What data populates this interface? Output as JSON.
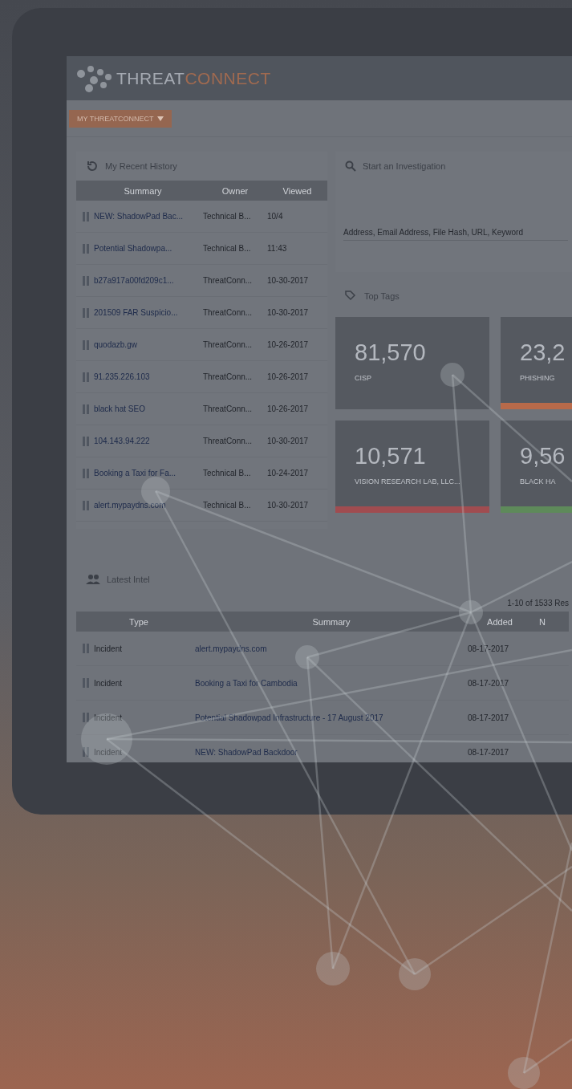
{
  "header": {
    "logo_primary": "THREAT",
    "logo_accent": "CONNECT"
  },
  "menu_button": "MY THREATCONNECT",
  "recent_history": {
    "title": "My Recent History",
    "columns": [
      "Summary",
      "Owner",
      "Viewed"
    ],
    "rows": [
      {
        "summary": "NEW: ShadowPad Bac...",
        "owner": "Technical B...",
        "viewed": "10/4"
      },
      {
        "summary": "Potential Shadowpa...",
        "owner": "Technical B...",
        "viewed": "11:43"
      },
      {
        "summary": "b27a917a00fd209c1...",
        "owner": "ThreatConn...",
        "viewed": "10-30-2017"
      },
      {
        "summary": "201509 FAR Suspicio...",
        "owner": "ThreatConn...",
        "viewed": "10-30-2017"
      },
      {
        "summary": "quodazb.gw",
        "owner": "ThreatConn...",
        "viewed": "10-26-2017"
      },
      {
        "summary": "91.235.226.103",
        "owner": "ThreatConn...",
        "viewed": "10-26-2017"
      },
      {
        "summary": "black hat SEO",
        "owner": "ThreatConn...",
        "viewed": "10-26-2017"
      },
      {
        "summary": "104.143.94.222",
        "owner": "ThreatConn...",
        "viewed": "10-30-2017"
      },
      {
        "summary": "Booking a Taxi for Fa...",
        "owner": "Technical B...",
        "viewed": "10-24-2017"
      },
      {
        "summary": "alert.mypaydns.com",
        "owner": "Technical B...",
        "viewed": "10-30-2017"
      }
    ]
  },
  "investigation": {
    "title": "Start an Investigation",
    "placeholder": "Address, Email Address, File Hash, URL, Keyword"
  },
  "top_tags": {
    "title": "Top Tags",
    "cards": [
      {
        "count": "81,570",
        "name": "CISP"
      },
      {
        "count": "23,2",
        "name": "PHISHING",
        "color": "#b86a4a"
      },
      {
        "count": "10,571",
        "name": "VISION RESEARCH LAB, LLC...",
        "color": "#a04c50"
      },
      {
        "count": "9,56",
        "name": "BLACK HA",
        "color": "#5e8a5a"
      }
    ]
  },
  "latest_intel": {
    "title": "Latest Intel",
    "pagination": "1-10 of 1533 Res",
    "columns": [
      "Type",
      "Summary",
      "Added",
      "N"
    ],
    "rows": [
      {
        "type": "Incident",
        "summary": "alert.mypaydns.com",
        "added": "08-17-2017"
      },
      {
        "type": "Incident",
        "summary": "Booking a Taxi for Cambodia",
        "added": "08-17-2017"
      },
      {
        "type": "Incident",
        "summary": "Potential Shadowpad Infrastructure - 17 August 2017",
        "added": "08-17-2017"
      },
      {
        "type": "Incident",
        "summary": "NEW: ShadowPad Backdoor",
        "added": "08-17-2017"
      }
    ]
  }
}
